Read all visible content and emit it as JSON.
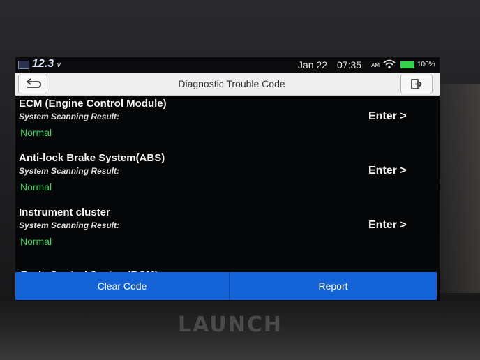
{
  "status_bar": {
    "voltage_value": "12.3",
    "voltage_unit": "v",
    "date": "Jan 22",
    "time": "07:35",
    "ampm": "AM",
    "battery_percent": "100%",
    "icons": [
      "battery-voltage-icon",
      "wifi-icon",
      "battery-icon"
    ]
  },
  "header": {
    "title": "Diagnostic Trouble Code",
    "back_icon": "back-arrow-icon",
    "exit_icon": "exit-icon"
  },
  "systems": [
    {
      "name": "ECM (Engine Control Module)",
      "subtitle": "System Scanning Result:",
      "status": "Normal",
      "action": "Enter >"
    },
    {
      "name": "Anti-lock Brake System(ABS)",
      "subtitle": "System Scanning Result:",
      "status": "Normal",
      "action": "Enter >"
    },
    {
      "name": "Instrument cluster",
      "subtitle": "System Scanning Result:",
      "status": "Normal",
      "action": "Enter >"
    },
    {
      "name": "Body Control System(BCM)"
    }
  ],
  "footer": {
    "clear_label": "Clear Code",
    "report_label": "Report"
  },
  "device": {
    "brand": "LAUNCH"
  },
  "colors": {
    "status_normal": "#39d45a",
    "action_bar": "#1463d6",
    "title_bar": "#efefef"
  }
}
